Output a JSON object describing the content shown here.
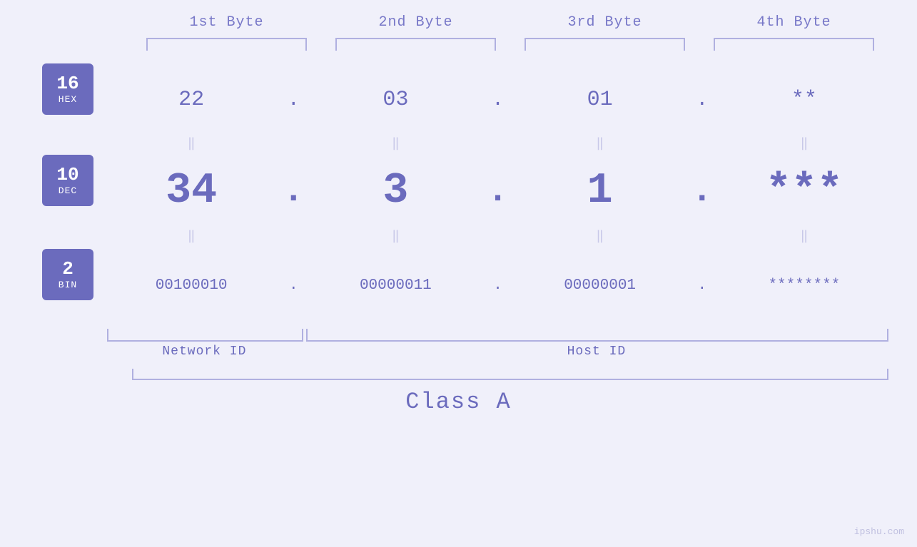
{
  "header": {
    "byte1_label": "1st Byte",
    "byte2_label": "2nd Byte",
    "byte3_label": "3rd Byte",
    "byte4_label": "4th Byte"
  },
  "badges": {
    "hex": {
      "number": "16",
      "label": "HEX"
    },
    "dec": {
      "number": "10",
      "label": "DEC"
    },
    "bin": {
      "number": "2",
      "label": "BIN"
    }
  },
  "rows": {
    "hex": {
      "b1": "22",
      "b2": "03",
      "b3": "01",
      "b4": "**",
      "dot": "."
    },
    "dec": {
      "b1": "34",
      "b2": "3",
      "b3": "1",
      "b4": "***",
      "dot": "."
    },
    "bin": {
      "b1": "00100010",
      "b2": "00000011",
      "b3": "00000001",
      "b4": "********",
      "dot": "."
    }
  },
  "labels": {
    "network_id": "Network ID",
    "host_id": "Host ID",
    "class": "Class A"
  },
  "watermark": "ipshu.com"
}
